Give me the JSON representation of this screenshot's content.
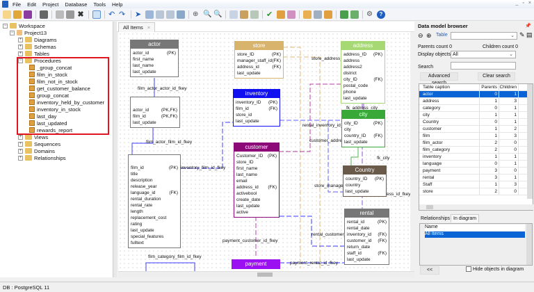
{
  "menu": [
    "File",
    "Edit",
    "Project",
    "Database",
    "Tools",
    "Help"
  ],
  "tree": {
    "workspace": "Workspace",
    "project": "Project13",
    "folders_top": [
      "Diagrams",
      "Schemas",
      "Tables"
    ],
    "procedures_label": "Procedures",
    "procedures": [
      "_group_concat",
      "film_in_stock",
      "film_not_in_stock",
      "get_customer_balance",
      "group_concat",
      "inventory_held_by_customer",
      "inventory_in_stock",
      "last_day",
      "last_updated",
      "rewards_report"
    ],
    "folders_bottom": [
      "Views",
      "Sequences",
      "Domains",
      "Relationships"
    ]
  },
  "tab": {
    "label": "All Items",
    "close": "×"
  },
  "entities": {
    "actor": {
      "title": "actor",
      "rows": [
        [
          "actor_id",
          "(PK)"
        ],
        [
          "first_name",
          ""
        ],
        [
          "last_name",
          ""
        ],
        [
          "last_update",
          ""
        ]
      ]
    },
    "film_actor": {
      "title": "film_actor",
      "rows": [
        [
          "actor_id",
          "(PK,FK)"
        ],
        [
          "film_id",
          "(PK,FK)"
        ],
        [
          "last_update",
          ""
        ]
      ]
    },
    "film": {
      "title": "film",
      "rows": [
        [
          "film_id",
          "(PK)"
        ],
        [
          "title",
          ""
        ],
        [
          "description",
          ""
        ],
        [
          "release_year",
          ""
        ],
        [
          "language_id",
          "(FK)"
        ],
        [
          "rental_duration",
          ""
        ],
        [
          "rental_rate",
          ""
        ],
        [
          "length",
          ""
        ],
        [
          "replacement_cost",
          ""
        ],
        [
          "rating",
          ""
        ],
        [
          "last_update",
          ""
        ],
        [
          "special_features",
          ""
        ],
        [
          "fulltext",
          ""
        ]
      ]
    },
    "store": {
      "title": "store",
      "rows": [
        [
          "store_ID",
          "(PK)"
        ],
        [
          "manager_staff_id",
          "(FK)"
        ],
        [
          "address_id",
          "(FK)"
        ],
        [
          "last_update",
          ""
        ]
      ]
    },
    "inventory": {
      "title": "inventory",
      "rows": [
        [
          "inventory_ID",
          "(PK)"
        ],
        [
          "film_id",
          "(FK)"
        ],
        [
          "store_id",
          ""
        ],
        [
          "last_update",
          ""
        ]
      ]
    },
    "customer": {
      "title": "customer",
      "rows": [
        [
          "Customer_ID",
          "(PK)"
        ],
        [
          "store_ID",
          ""
        ],
        [
          "first_name",
          ""
        ],
        [
          "last_name",
          ""
        ],
        [
          "email",
          ""
        ],
        [
          "address_id",
          "(FK)"
        ],
        [
          "activebool",
          ""
        ],
        [
          "create_date",
          ""
        ],
        [
          "last_update",
          ""
        ],
        [
          "active",
          ""
        ]
      ]
    },
    "payment": {
      "title": "payment",
      "rows": []
    },
    "address": {
      "title": "address",
      "rows": [
        [
          "address_ID",
          "(PK)"
        ],
        [
          "address",
          ""
        ],
        [
          "address2",
          ""
        ],
        [
          "district",
          ""
        ],
        [
          "city_ID",
          "(FK)"
        ],
        [
          "postal_code",
          ""
        ],
        [
          "phone",
          ""
        ],
        [
          "last_update",
          ""
        ]
      ]
    },
    "city": {
      "title": "city",
      "rows": [
        [
          "city_ID",
          "(PK)"
        ],
        [
          "city",
          ""
        ],
        [
          "country_ID",
          "(FK)"
        ],
        [
          "last_update",
          ""
        ]
      ]
    },
    "country": {
      "title": "Country",
      "rows": [
        [
          "country_ID",
          "(PK)"
        ],
        [
          "country",
          ""
        ],
        [
          "last_update",
          ""
        ]
      ]
    },
    "rental": {
      "title": "rental",
      "rows": [
        [
          "rental_id",
          "(PK)"
        ],
        [
          "rental_date",
          ""
        ],
        [
          "inventory_id",
          "(FK)"
        ],
        [
          "customer_id",
          "(FK)"
        ],
        [
          "return_date",
          ""
        ],
        [
          "staff_id",
          "(FK)"
        ],
        [
          "last_update",
          ""
        ]
      ]
    }
  },
  "relations": {
    "film_actor_actor": "film_actor_actor_id_fkey",
    "film_actor_film": "film_actor_film_id_fkey",
    "inventory_film": "inventory_film_id_fkey",
    "store_address": "store_address_",
    "rental_inventory": "rental_inventory_id_",
    "customer_address": "customer_addre",
    "fk_address_city": "fk_address_city",
    "fk_city": "fk_city",
    "store_manager": "store_manage",
    "address_id_fkey": "ress_id_fkey",
    "rental_customer": "rental_customer_",
    "payment_customer": "payment_customer_id_fkey",
    "payment_rental": "payment_rental_id_fkey",
    "film_category": "film_category_film_id_fkey"
  },
  "browser": {
    "title": "Data model browser",
    "table_label": "Table",
    "parents_count": "Parents count 0",
    "children_count": "Children count 0",
    "display_objects_label": "Display objects",
    "display_objects_value": "All",
    "search_label": "Search",
    "advanced_search": "Advanced search",
    "clear_search": "Clear search",
    "columns": [
      "Table caption",
      "Parents",
      "Children"
    ],
    "rows": [
      [
        "actor",
        "0",
        "1"
      ],
      [
        "address",
        "1",
        "3"
      ],
      [
        "category",
        "0",
        "1"
      ],
      [
        "city",
        "1",
        "1"
      ],
      [
        "Country",
        "0",
        "1"
      ],
      [
        "customer",
        "1",
        "2"
      ],
      [
        "film",
        "1",
        "3"
      ],
      [
        "film_actor",
        "2",
        "0"
      ],
      [
        "film_category",
        "2",
        "0"
      ],
      [
        "inventory",
        "1",
        "1"
      ],
      [
        "language",
        "0",
        "1"
      ],
      [
        "payment",
        "3",
        "0"
      ],
      [
        "rental",
        "3",
        "1"
      ],
      [
        "Staff",
        "1",
        "3"
      ],
      [
        "store",
        "2",
        "0"
      ]
    ],
    "tabs": [
      "Relationships",
      "In diagram"
    ],
    "list_header": "Name",
    "list_items": [
      "All Items"
    ],
    "collapse_button": "<<",
    "hide_objects": "Hide objects in diagram"
  },
  "status": "DB : PostgreSQL 11",
  "colors": {
    "actor": "#777777",
    "store": "#d8b36c",
    "inventory": "#1010f0",
    "customer": "#8c0a78",
    "payment": "#9a10f0",
    "address": "#a6d873",
    "city": "#38a838",
    "country": "#6a5a4a",
    "rental": "#777777",
    "selection": "#0a64d6",
    "highlight": "#e0141e"
  }
}
